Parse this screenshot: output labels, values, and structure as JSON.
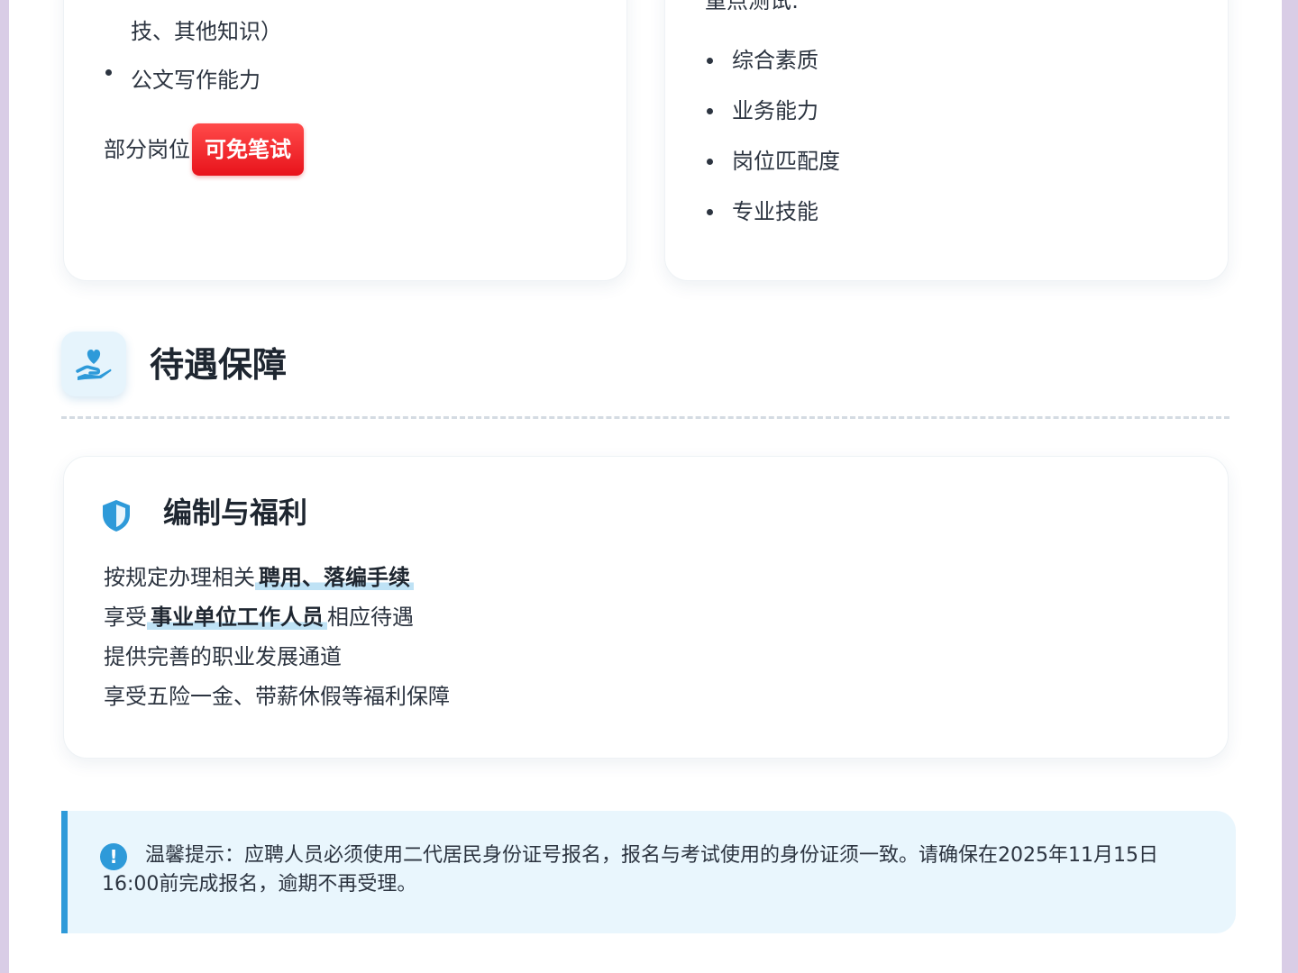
{
  "exam_left": {
    "items": [
      "综合能力（人文、历史、文化、经济、科技、其他知识）",
      "公文写作能力"
    ],
    "note_prefix": "部分岗位",
    "note_badge": "可免笔试"
  },
  "exam_right": {
    "heading": "重点测试:",
    "items": [
      "综合素质",
      "业务能力",
      "岗位匹配度",
      "专业技能"
    ]
  },
  "section": {
    "title": "待遇保障",
    "icon": "hand-heart-icon"
  },
  "benefits": {
    "title": "编制与福利",
    "icon": "shield-icon",
    "line1_prefix": "按规定办理相关",
    "line1_highlight": "聘用、落编手续",
    "line2_prefix": "享受",
    "line2_highlight": "事业单位工作人员",
    "line2_suffix": "相应待遇",
    "line3": "提供完善的职业发展通道",
    "line4": "享受五险一金、带薪休假等福利保障"
  },
  "tip": {
    "icon": "exclamation-icon",
    "text": "温馨提示：应聘人员必须使用二代居民身份证号报名，报名与考试使用的身份证须一致。请确保在2025年11月15日16:00前完成报名，逾期不再受理。"
  },
  "colors": {
    "accent": "#2e9ad9",
    "badge_red": "#e8131b",
    "highlight": "#bfe2f5",
    "tip_bg": "#e9f6fd",
    "frame": "#d9cde6"
  }
}
